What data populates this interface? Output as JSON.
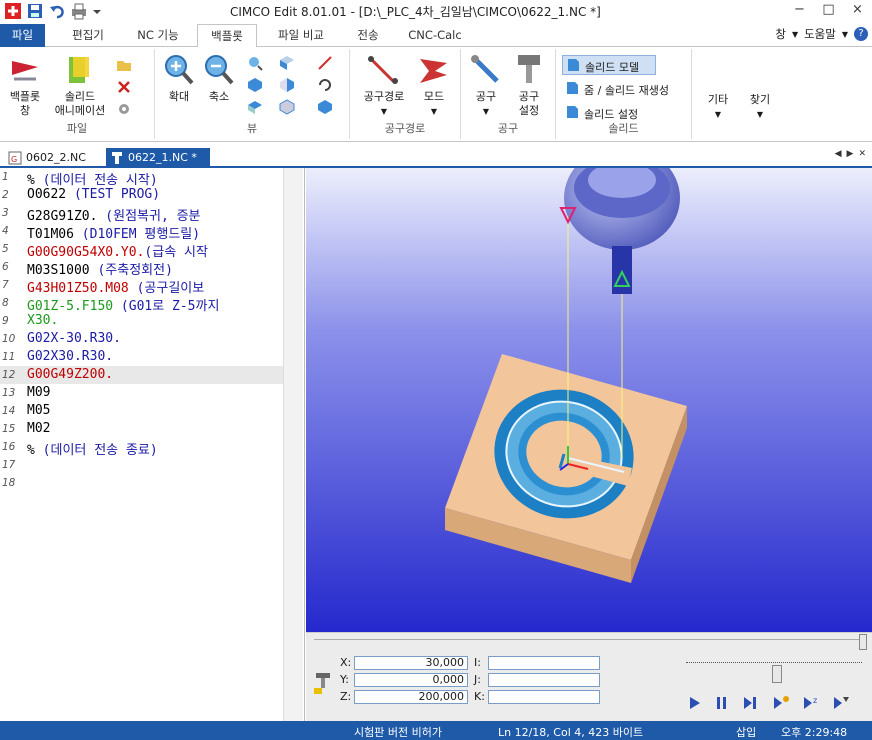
{
  "window": {
    "title": "CIMCO Edit 8.01.01 - [D:\\_PLC_4차_김일남\\CIMCO\\0622_1.NC *]",
    "minimize": "−",
    "maximize": "□",
    "close": "×"
  },
  "tabs": {
    "file": "파일",
    "items": [
      "편집기",
      "NC 기능",
      "백플롯",
      "파일 비교",
      "전송",
      "CNC-Calc"
    ],
    "active_index": 2,
    "window_menu": "창",
    "help_menu": "도움말"
  },
  "ribbon": {
    "groups": {
      "file": "파일",
      "view": "뷰",
      "toolpath": "공구경로",
      "tool": "공구",
      "solid": "솔리드"
    },
    "backplot_window": [
      "백플롯",
      "창"
    ],
    "solid_animation": [
      "솔리드",
      "애니메이션"
    ],
    "zoom_in": "확대",
    "zoom_out": "축소",
    "toolpath_btn": "공구경로",
    "mode_btn": "모드",
    "tool_btn": "공구",
    "tool_setup": [
      "공구",
      "설정"
    ],
    "solid_model": "솔리드 모델",
    "zoom_solid_regen": "줌 / 솔리드 재생성",
    "solid_settings": "솔리드 설정",
    "other": "기타",
    "find": "찾기"
  },
  "doc_tabs": [
    {
      "label": "0602_2.NC"
    },
    {
      "label": "0622_1.NC *"
    }
  ],
  "code_lines": [
    {
      "n": "1",
      "segs": [
        {
          "t": "% ",
          "c": "#000"
        },
        {
          "t": "(데이터 전송 시작)",
          "c": "#1a1aa6"
        }
      ]
    },
    {
      "n": "2",
      "segs": [
        {
          "t": "O0622 ",
          "c": "#000"
        },
        {
          "t": "(TEST PROG)",
          "c": "#1a1aa6"
        }
      ]
    },
    {
      "n": "3",
      "segs": [
        {
          "t": "G28G91Z0. ",
          "c": "#000"
        },
        {
          "t": "(원점복귀, 증분",
          "c": "#1a1aa6"
        }
      ]
    },
    {
      "n": "4",
      "segs": [
        {
          "t": "T01M06 ",
          "c": "#000"
        },
        {
          "t": "(D10FEM 평행드릴)",
          "c": "#1a1aa6"
        }
      ]
    },
    {
      "n": "5",
      "segs": [
        {
          "t": "G00G90G54X0.Y0.",
          "c": "#c00000"
        },
        {
          "t": "(급속 시작",
          "c": "#1a1aa6"
        }
      ]
    },
    {
      "n": "6",
      "segs": [
        {
          "t": "M03S1000 ",
          "c": "#000"
        },
        {
          "t": "(주축정회전)",
          "c": "#1a1aa6"
        }
      ]
    },
    {
      "n": "7",
      "segs": [
        {
          "t": "G43H01Z50.M08 ",
          "c": "#c00000"
        },
        {
          "t": "(공구길이보",
          "c": "#1a1aa6"
        }
      ]
    },
    {
      "n": "8",
      "segs": [
        {
          "t": "G01Z-5.F150 ",
          "c": "#1a9a1a"
        },
        {
          "t": "(G01로 Z-5까지",
          "c": "#1a1aa6"
        }
      ]
    },
    {
      "n": "9",
      "segs": [
        {
          "t": "X30.",
          "c": "#1a9a1a"
        }
      ]
    },
    {
      "n": "10",
      "segs": [
        {
          "t": "G02X-30.R30.",
          "c": "#1a1aa6"
        }
      ]
    },
    {
      "n": "11",
      "segs": [
        {
          "t": "G02X30.R30.",
          "c": "#1a1aa6"
        }
      ]
    },
    {
      "n": "12",
      "segs": [
        {
          "t": "G00G49Z200.",
          "c": "#c00000"
        }
      ]
    },
    {
      "n": "13",
      "segs": [
        {
          "t": "M09",
          "c": "#000"
        }
      ]
    },
    {
      "n": "14",
      "segs": [
        {
          "t": "M05",
          "c": "#000"
        }
      ]
    },
    {
      "n": "15",
      "segs": [
        {
          "t": "M02",
          "c": "#000"
        }
      ]
    },
    {
      "n": "16",
      "segs": [
        {
          "t": "% ",
          "c": "#000"
        },
        {
          "t": "(데이터 전송 종료)",
          "c": "#1a1aa6"
        }
      ]
    },
    {
      "n": "17",
      "segs": []
    },
    {
      "n": "18",
      "segs": []
    }
  ],
  "highlighted_line": "12",
  "sim": {
    "x_label": "X:",
    "x": "30,000",
    "y_label": "Y:",
    "y": "0,000",
    "z_label": "Z:",
    "z": "200,000",
    "i_label": "I:",
    "j_label": "J:",
    "k_label": "K:"
  },
  "status": {
    "trial": "시험판 버전 비허가",
    "position": "Ln 12/18, Col 4, 423 바이트",
    "insert": "삽입",
    "time": "오후 2:29:48"
  },
  "colors": {
    "accent": "#1e5aa8",
    "viewport_top": "#e6e8fb",
    "viewport_bottom": "#2a2ed0",
    "stock": "#f2c59a"
  }
}
